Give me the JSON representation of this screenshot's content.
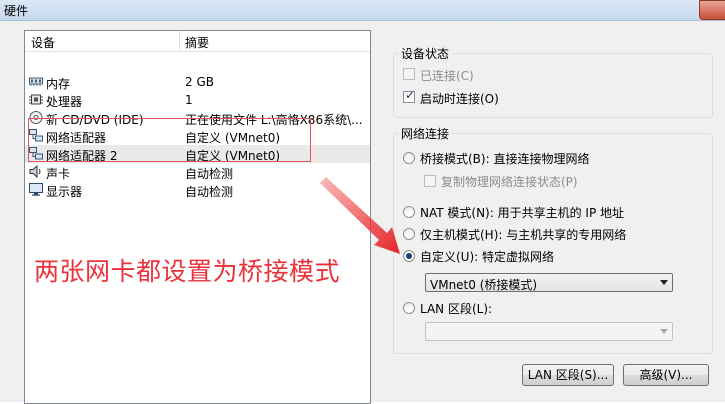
{
  "window": {
    "title": "硬件"
  },
  "device_list": {
    "col_device": "设备",
    "col_summary": "摘要",
    "rows": [
      {
        "name": "内存",
        "summary": "2 GB",
        "icon": "memory-icon"
      },
      {
        "name": "处理器",
        "summary": "1",
        "icon": "cpu-icon"
      },
      {
        "name": "新 CD/DVD (IDE)",
        "summary": "正在使用文件 L:\\高恪X86系统\\...",
        "icon": "cd-dvd-icon"
      },
      {
        "name": "网络适配器",
        "summary": "自定义 (VMnet0)",
        "icon": "network-adapter-icon"
      },
      {
        "name": "网络适配器 2",
        "summary": "自定义 (VMnet0)",
        "icon": "network-adapter-icon"
      },
      {
        "name": "声卡",
        "summary": "自动检测",
        "icon": "speaker-icon"
      },
      {
        "name": "显示器",
        "summary": "自动检测",
        "icon": "monitor-icon"
      }
    ]
  },
  "device_status": {
    "title": "设备状态",
    "connected": {
      "label": "已连接(C)",
      "checked": false,
      "enabled": false
    },
    "connect_on_power": {
      "label": "启动时连接(O)",
      "checked": true
    }
  },
  "network": {
    "title": "网络连接",
    "bridged": "桥接模式(B): 直接连接物理网络",
    "replicate": "复制物理网络连接状态(P)",
    "nat": "NAT 模式(N): 用于共享主机的 IP 地址",
    "host_only": "仅主机模式(H): 与主机共享的专用网络",
    "custom": "自定义(U): 特定虚拟网络",
    "custom_value": "VMnet0 (桥接模式)",
    "lan": "LAN 区段(L):",
    "lan_value": "",
    "selected": "custom"
  },
  "buttons": {
    "lan_segments": "LAN 区段(S)...",
    "advanced": "高级(V)..."
  },
  "annotation": {
    "text": "两张网卡都设置为桥接模式",
    "color": "#e8333a"
  }
}
